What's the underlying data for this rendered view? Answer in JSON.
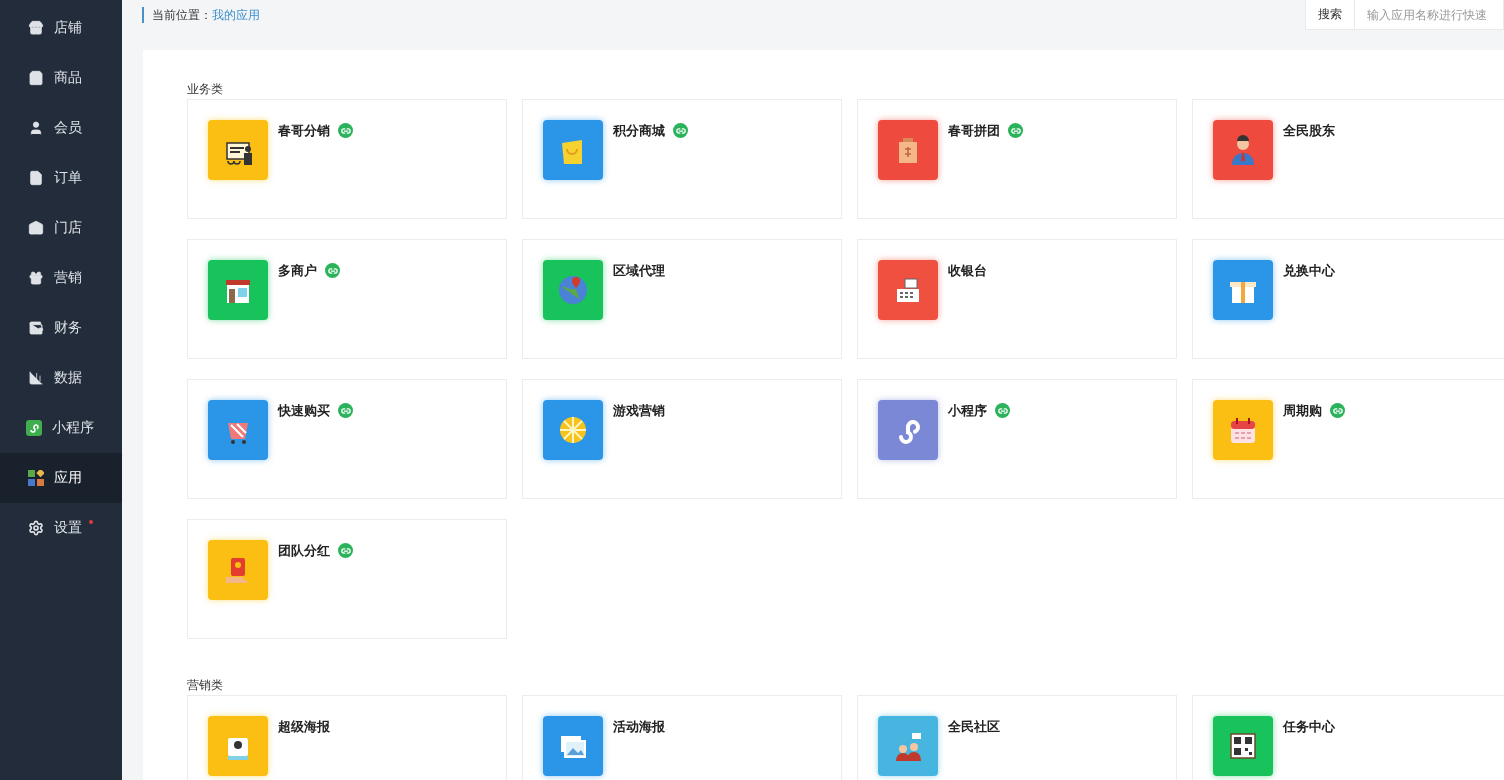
{
  "sidebar": {
    "items": [
      {
        "label": "店铺",
        "selected": false,
        "notice": false
      },
      {
        "label": "商品",
        "selected": false,
        "notice": false
      },
      {
        "label": "会员",
        "selected": false,
        "notice": false
      },
      {
        "label": "订单",
        "selected": false,
        "notice": false
      },
      {
        "label": "门店",
        "selected": false,
        "notice": false
      },
      {
        "label": "营销",
        "selected": false,
        "notice": false
      },
      {
        "label": "财务",
        "selected": false,
        "notice": false
      },
      {
        "label": "数据",
        "selected": false,
        "notice": false
      },
      {
        "label": "小程序",
        "selected": false,
        "notice": false
      },
      {
        "label": "应用",
        "selected": true,
        "notice": false
      },
      {
        "label": "设置",
        "selected": false,
        "notice": true
      }
    ]
  },
  "breadcrumb": {
    "label": "当前位置：",
    "current": "我的应用"
  },
  "search": {
    "button": "搜索",
    "placeholder": "输入应用名称进行快速"
  },
  "sections": [
    {
      "title": "业务类",
      "apps": [
        {
          "name": "春哥分销",
          "color": "#fbbf13",
          "linked": true
        },
        {
          "name": "积分商城",
          "color": "#2b96e8",
          "linked": true
        },
        {
          "name": "春哥拼团",
          "color": "#ee4b3e",
          "linked": true
        },
        {
          "name": "全民股东",
          "color": "#ee4b3e",
          "linked": false
        },
        {
          "name": "多商户",
          "color": "#17c35a",
          "linked": true
        },
        {
          "name": "区域代理",
          "color": "#17c35a",
          "linked": false
        },
        {
          "name": "收银台",
          "color": "#f0503f",
          "linked": false
        },
        {
          "name": "兑换中心",
          "color": "#2b96e8",
          "linked": false
        },
        {
          "name": "快速购买",
          "color": "#2b96e8",
          "linked": true
        },
        {
          "name": "游戏营销",
          "color": "#2b96e8",
          "linked": false
        },
        {
          "name": "小程序",
          "color": "#7b88d6",
          "linked": true
        },
        {
          "name": "周期购",
          "color": "#fbbf13",
          "linked": true
        },
        {
          "name": "团队分红",
          "color": "#fbbf13",
          "linked": true
        }
      ]
    },
    {
      "title": "营销类",
      "apps": [
        {
          "name": "超级海报",
          "color": "#fbbf13",
          "linked": false
        },
        {
          "name": "活动海报",
          "color": "#2b96e8",
          "linked": false
        },
        {
          "name": "全民社区",
          "color": "#46b6e0",
          "linked": false
        },
        {
          "name": "任务中心",
          "color": "#17c35a",
          "linked": false
        }
      ]
    }
  ]
}
